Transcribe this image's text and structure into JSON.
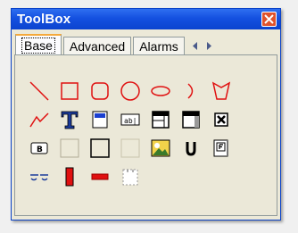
{
  "window": {
    "title": "ToolBox"
  },
  "tabs": [
    {
      "label": "Base",
      "active": true
    },
    {
      "label": "Advanced",
      "active": false
    },
    {
      "label": "Alarms",
      "active": false
    }
  ],
  "tools": [
    "line-tool-icon",
    "rectangle-tool-icon",
    "rounded-rectangle-tool-icon",
    "circle-tool-icon",
    "ellipse-tool-icon",
    "arc-tool-icon",
    "polygon-tool-icon",
    "polyline-tool-icon",
    "text-tool-icon",
    "button-tool-icon",
    "textbox-tool-icon",
    "window-tool-icon",
    "panel-tool-icon",
    "checkbox-tool-icon",
    "radio-tool-icon",
    "frame-tool-icon",
    "border-tool-icon",
    "blank-tool-icon",
    "image-tool-icon",
    "unicode-tool-icon",
    "form-tool-icon",
    "link-tool-icon",
    "bar-tool-icon",
    "slider-tool-icon",
    "page-tool-icon"
  ],
  "colors": {
    "shape_red": "#e01010",
    "title_blue": "#0b44cf"
  }
}
